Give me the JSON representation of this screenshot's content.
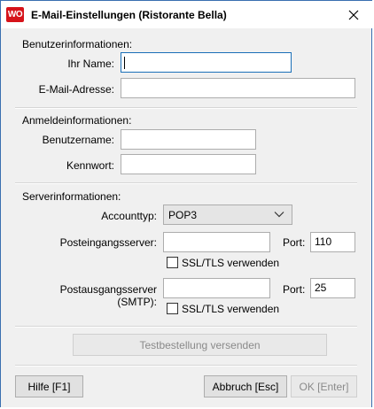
{
  "window": {
    "title": "E-Mail-Einstellungen (Ristorante Bella)",
    "app_icon_text": "WO"
  },
  "user_info": {
    "heading": "Benutzerinformationen:",
    "name_label": "Ihr Name:",
    "name_value": "",
    "email_label": "E-Mail-Adresse:",
    "email_value": ""
  },
  "login_info": {
    "heading": "Anmeldeinformationen:",
    "username_label": "Benutzername:",
    "username_value": "",
    "password_label": "Kennwort:",
    "password_value": ""
  },
  "server_info": {
    "heading": "Serverinformationen:",
    "account_type_label": "Accounttyp:",
    "account_type_value": "POP3",
    "incoming_label": "Posteingangsserver:",
    "incoming_value": "",
    "incoming_port_label": "Port:",
    "incoming_port_value": "110",
    "incoming_ssl_label": "SSL/TLS verwenden",
    "incoming_ssl_checked": false,
    "outgoing_label": "Postausgangsserver (SMTP):",
    "outgoing_value": "",
    "outgoing_port_label": "Port:",
    "outgoing_port_value": "25",
    "outgoing_ssl_label": "SSL/TLS verwenden",
    "outgoing_ssl_checked": false
  },
  "buttons": {
    "test_order": "Testbestellung versenden",
    "help": "Hilfe [F1]",
    "cancel": "Abbruch [Esc]",
    "ok": "OK [Enter]"
  }
}
